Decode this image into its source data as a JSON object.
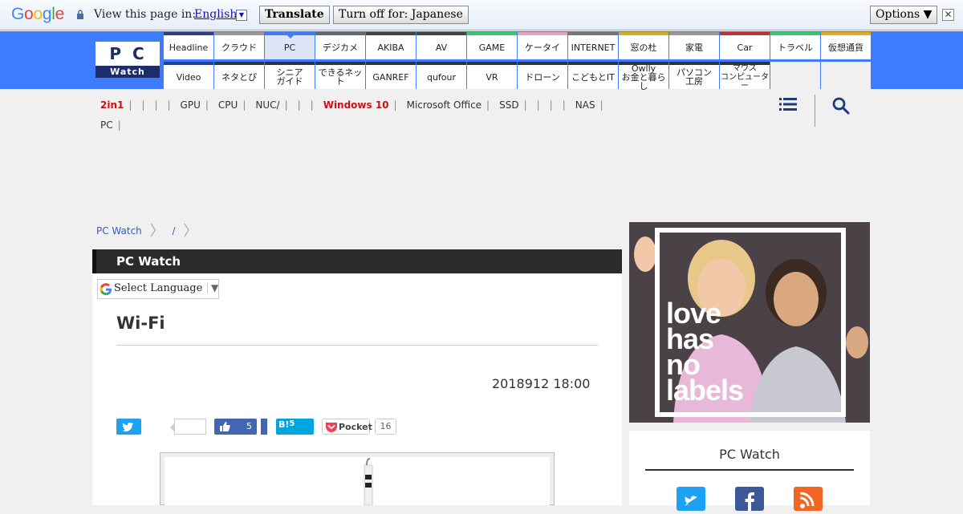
{
  "translate_bar": {
    "view_label": "View this page in:",
    "language": "English",
    "translate_button": "Translate",
    "turn_off_button": "Turn off for: Japanese",
    "options_button": "Options ▼"
  },
  "logo": {
    "top": "PC",
    "bottom": "Watch"
  },
  "nav": {
    "row1": [
      "Headline",
      "クラウド",
      "PC",
      "デジカメ",
      "AKIBA",
      "AV",
      "GAME",
      "ケータイ",
      "INTERNET",
      "窓の杜",
      "家電",
      "Car",
      "トラベル",
      "仮想通貨"
    ],
    "row2": [
      {
        "l1": "Video",
        "l2": ""
      },
      {
        "l1": "ネタとぴ",
        "l2": ""
      },
      {
        "l1": "シニア",
        "l2": "ガイド"
      },
      {
        "l1": "できるネット",
        "l2": ""
      },
      {
        "l1": "GANREF",
        "l2": ""
      },
      {
        "l1": "qufour",
        "l2": ""
      },
      {
        "l1": "VR",
        "l2": ""
      },
      {
        "l1": "ドローン",
        "l2": ""
      },
      {
        "l1": "こどもとIT",
        "l2": ""
      },
      {
        "l1": "Owlly",
        "l2": "お金と暮らし"
      },
      {
        "l1": "パソコン",
        "l2": "工房"
      },
      {
        "l1": "マウス",
        "l2": "コンピューター"
      }
    ],
    "row1_colors": [
      "#2c3e8c",
      "#999999",
      "#3d7bff",
      "#5d6a7a",
      "#444444",
      "#444444",
      "#2ecc71",
      "#e8a0c8",
      "#777777",
      "#d4b020",
      "#999999",
      "#c0303a",
      "#2ecc71",
      "#e8a820"
    ],
    "row2_colors": [
      "#2c3e8c",
      "#333333",
      "#333333",
      "#333333",
      "#333333",
      "#333333",
      "#333333",
      "#333333",
      "#333333",
      "#333333",
      "#333333",
      "#333333"
    ]
  },
  "topics": {
    "row1": [
      "2in1",
      "|",
      "|",
      "|",
      "|",
      "GPU",
      "|",
      "CPU",
      "|",
      "NUC/",
      "|",
      "|",
      "|",
      "Windows 10",
      "|",
      "Microsoft Office",
      "|",
      "SSD",
      "|",
      "|",
      "|",
      "|",
      "NAS",
      "|"
    ],
    "row2": [
      "PC",
      "|"
    ]
  },
  "breadcrumb": {
    "home": "PC Watch",
    "sub": "/"
  },
  "article": {
    "section_title": "PC Watch",
    "select_language": "Select Language",
    "select_caret": "▼",
    "title": "Wi-Fi",
    "date": "2018912 18:00",
    "fb_count": "5",
    "hb_label": "B!",
    "hb_count": "5",
    "pocket_label": "Pocket",
    "pocket_count": "16"
  },
  "ad": {
    "text_lines": [
      "love",
      "has",
      "no",
      "labels"
    ]
  },
  "side": {
    "title": "PC Watch"
  },
  "colors": {
    "nav_blue": "#3d7bff",
    "twitter": "#1da1f2",
    "facebook": "#4267b2",
    "hatena": "#00a4de",
    "pocket": "#ef4056",
    "red_topic": "#d01010"
  }
}
